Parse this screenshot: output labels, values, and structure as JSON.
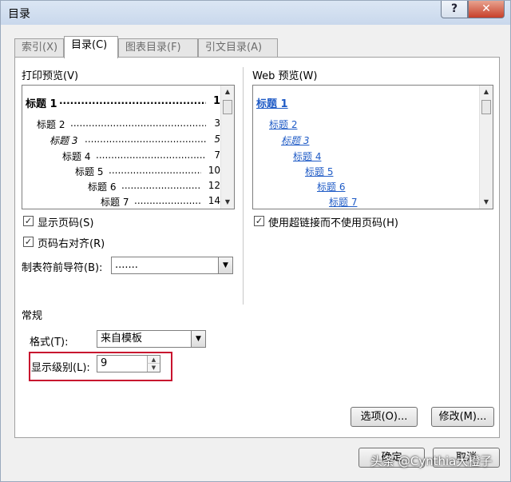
{
  "window": {
    "title": "目录",
    "help_label": "?",
    "close_label": "✕"
  },
  "tabs": [
    {
      "label": "索引(X)"
    },
    {
      "label": "目录(C)"
    },
    {
      "label": "图表目录(F)"
    },
    {
      "label": "引文目录(A)"
    }
  ],
  "print_preview": {
    "label": "打印预览(V)",
    "entries": [
      {
        "text": "标题 1",
        "leader": ".......................................................",
        "page": "1"
      },
      {
        "text": "标题 2",
        "leader": "..................................................",
        "page": "3"
      },
      {
        "text": "标题 3",
        "leader": "...............................................",
        "page": "5"
      },
      {
        "text": "标题 4",
        "leader": "...........................................",
        "page": "7"
      },
      {
        "text": "标题 5",
        "leader": "......................................",
        "page": "10"
      },
      {
        "text": "标题 6",
        "leader": "..................................",
        "page": "12"
      },
      {
        "text": "标题 7",
        "leader": "...............................",
        "page": "14"
      }
    ]
  },
  "web_preview": {
    "label": "Web 预览(W)",
    "entries": [
      "标题 1",
      "标题 2",
      "标题 3",
      "标题 4",
      "标题 5",
      "标题 6",
      "标题 7"
    ]
  },
  "options": {
    "show_page_numbers": {
      "label": "显示页码(S)",
      "checked": true
    },
    "right_align": {
      "label": "页码右对齐(R)",
      "checked": true
    },
    "hyperlinks": {
      "label": "使用超链接而不使用页码(H)",
      "checked": true
    },
    "tab_leader": {
      "label": "制表符前导符(B):",
      "value": "......."
    }
  },
  "general": {
    "label": "常规",
    "format": {
      "label": "格式(T):",
      "value": "来自模板"
    },
    "levels": {
      "label": "显示级别(L):",
      "value": "9"
    }
  },
  "buttons": {
    "options": "选项(O)...",
    "modify": "修改(M)...",
    "ok": "确定",
    "cancel": "取消"
  },
  "watermark": "头条 @Cynthia大橙子",
  "colors": {
    "link": "#1f5bc6",
    "highlight": "#c8102e"
  }
}
